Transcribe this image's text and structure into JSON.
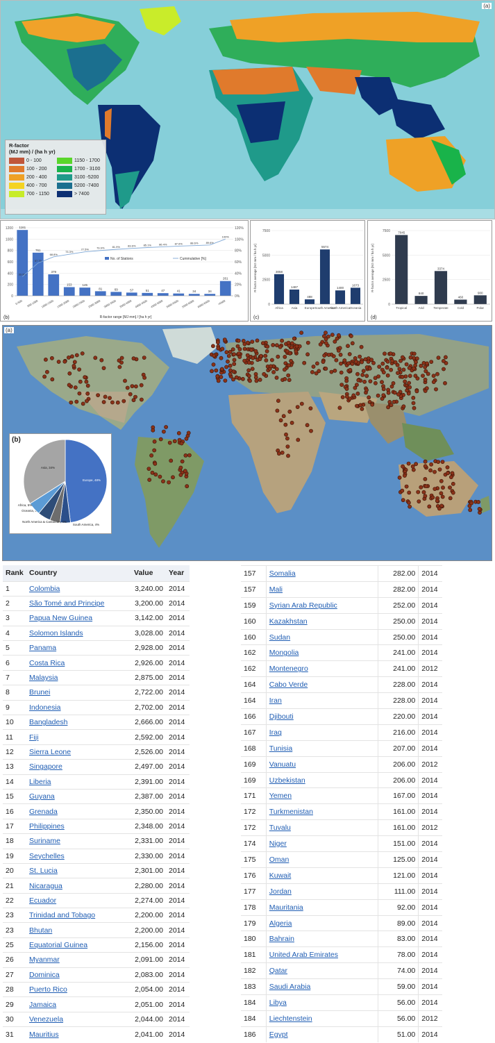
{
  "rfactor_map": {
    "label": "(a)",
    "legend_title": "R-factor\n(MJ mm) / (ha h yr)",
    "legend_title_line1": "R-factor",
    "legend_title_line2": "(MJ mm) / (ha h yr)",
    "legend": [
      {
        "label": "0 - 100",
        "color": "#c0563a"
      },
      {
        "label": "1150 - 1700",
        "color": "#59d62a"
      },
      {
        "label": "100 - 200",
        "color": "#e07a2c"
      },
      {
        "label": "1700 - 3100",
        "color": "#19b34a"
      },
      {
        "label": "200 - 400",
        "color": "#efa126"
      },
      {
        "label": "3100 -5200",
        "color": "#1f9a8a"
      },
      {
        "label": "400 - 700",
        "color": "#f4d322"
      },
      {
        "label": "5200 -7400",
        "color": "#1b6f8f"
      },
      {
        "label": "700 - 1150",
        "color": "#c7ec2a"
      },
      {
        "label": "> 7400",
        "color": "#0c2f73"
      }
    ]
  },
  "chart_b": {
    "label": "(b)",
    "series_bar": "No. of Stations",
    "series_line": "Cummulative [%]",
    "xlabel": "R-factor range [MJ mm] / [ha h yr]",
    "chart_data": {
      "type": "bar",
      "categories": [
        "0-500",
        "500-1000",
        "1000-1500",
        "1500-2000",
        "2000-2500",
        "2500-3000",
        "3000-3500",
        "3500-4000",
        "4000-4500",
        "4500-5000",
        "5000-5500",
        "5500-6000",
        "6000-6500",
        ">6500"
      ],
      "values": [
        1161,
        761,
        379,
        153,
        145,
        81,
        69,
        57,
        51,
        47,
        41,
        34,
        34,
        261
      ],
      "cumulative": [
        33.9,
        57.75,
        68.8,
        73.3,
        77.5,
        79.9,
        81.9,
        83.6,
        85.1,
        86.4,
        87.6,
        88.6,
        89.6,
        100
      ],
      "bar_labels": [
        "1161",
        "761",
        "379",
        "153",
        "145",
        "81",
        "69",
        "57",
        "51",
        "47",
        "41",
        "34",
        "34",
        "261"
      ],
      "cum_labels": [
        "33.9%",
        "57.75",
        "68.8%",
        "73.3%",
        "77.5%",
        "79.9%",
        "81.9%",
        "83.6%",
        "85.1%",
        "86.4%",
        "87.6%",
        "88.6%",
        "89.6%",
        "100%"
      ],
      "yticks": [
        "0",
        "200",
        "400",
        "600",
        "800",
        "1000",
        "1200"
      ],
      "y2ticks": [
        "0%",
        "20%",
        "40%",
        "60%",
        "80%",
        "100%",
        "120%"
      ],
      "ylim": [
        0,
        1200
      ]
    }
  },
  "chart_c": {
    "label": "(c)",
    "ylabel": "R-factor average [MJ mm / ha h yr]",
    "chart_data": {
      "type": "bar",
      "categories": [
        "Africa",
        "Asia",
        "Europe",
        "South America",
        "North America",
        "Oceania"
      ],
      "values": [
        3058,
        1487,
        488,
        5574,
        1400,
        1673
      ],
      "bar_labels": [
        "3058",
        "1487",
        "488",
        "5574",
        "1400",
        "1673"
      ],
      "yticks": [
        "0",
        "2500",
        "5000",
        "7500"
      ],
      "ylim": [
        0,
        7500
      ]
    }
  },
  "chart_d": {
    "label": "(d)",
    "ylabel": "R-factor average [MJ mm / ha h yr]",
    "chart_data": {
      "type": "bar",
      "categories": [
        "Tropical",
        "Arid",
        "Temperate",
        "Cold",
        "Polar"
      ],
      "values": [
        7045,
        840,
        3374,
        460,
        900
      ],
      "bar_labels": [
        "7045",
        "840",
        "3374",
        "460",
        "900"
      ],
      "yticks": [
        "0",
        "2500",
        "5000",
        "7500"
      ],
      "ylim": [
        0,
        7500
      ]
    }
  },
  "station_map": {
    "label": "(a)",
    "pie_label": "(b)",
    "pie_data": {
      "type": "pie",
      "slices": [
        {
          "name": "Europe, 48%",
          "value": 48,
          "color": "#4472c4"
        },
        {
          "name": "South America, 4%",
          "value": 4,
          "color": "#2b4f8a"
        },
        {
          "name": "North America & Caribbean, 4%",
          "value": 4,
          "color": "#6d6d6d"
        },
        {
          "name": "Oceania, 5%",
          "value": 5,
          "color": "#2e4d78"
        },
        {
          "name": "Africa, 5%",
          "value": 5,
          "color": "#5b9bd5"
        },
        {
          "name": "Asia, 34%",
          "value": 34,
          "color": "#a5a5a5"
        }
      ]
    }
  },
  "table_left": {
    "headers": [
      "Rank",
      "Country",
      "Value",
      "Year"
    ],
    "rows": [
      [
        "1",
        "Colombia",
        "3,240.00",
        "2014"
      ],
      [
        "2",
        "São Tomé and Principe",
        "3,200.00",
        "2014"
      ],
      [
        "3",
        "Papua New Guinea",
        "3,142.00",
        "2014"
      ],
      [
        "4",
        "Solomon Islands",
        "3,028.00",
        "2014"
      ],
      [
        "5",
        "Panama",
        "2,928.00",
        "2014"
      ],
      [
        "6",
        "Costa Rica",
        "2,926.00",
        "2014"
      ],
      [
        "7",
        "Malaysia",
        "2,875.00",
        "2014"
      ],
      [
        "8",
        "Brunei",
        "2,722.00",
        "2014"
      ],
      [
        "9",
        "Indonesia",
        "2,702.00",
        "2014"
      ],
      [
        "10",
        "Bangladesh",
        "2,666.00",
        "2014"
      ],
      [
        "11",
        "Fiji",
        "2,592.00",
        "2014"
      ],
      [
        "12",
        "Sierra Leone",
        "2,526.00",
        "2014"
      ],
      [
        "13",
        "Singapore",
        "2,497.00",
        "2014"
      ],
      [
        "14",
        "Liberia",
        "2,391.00",
        "2014"
      ],
      [
        "15",
        "Guyana",
        "2,387.00",
        "2014"
      ],
      [
        "16",
        "Grenada",
        "2,350.00",
        "2014"
      ],
      [
        "17",
        "Philippines",
        "2,348.00",
        "2014"
      ],
      [
        "18",
        "Suriname",
        "2,331.00",
        "2014"
      ],
      [
        "19",
        "Seychelles",
        "2,330.00",
        "2014"
      ],
      [
        "20",
        "St. Lucia",
        "2,301.00",
        "2014"
      ],
      [
        "21",
        "Nicaragua",
        "2,280.00",
        "2014"
      ],
      [
        "22",
        "Ecuador",
        "2,274.00",
        "2014"
      ],
      [
        "23",
        "Trinidad and Tobago",
        "2,200.00",
        "2014"
      ],
      [
        "23",
        "Bhutan",
        "2,200.00",
        "2014"
      ],
      [
        "25",
        "Equatorial Guinea",
        "2,156.00",
        "2014"
      ],
      [
        "26",
        "Myanmar",
        "2,091.00",
        "2014"
      ],
      [
        "27",
        "Dominica",
        "2,083.00",
        "2014"
      ],
      [
        "28",
        "Puerto Rico",
        "2,054.00",
        "2014"
      ],
      [
        "29",
        "Jamaica",
        "2,051.00",
        "2014"
      ],
      [
        "30",
        "Venezuela",
        "2,044.00",
        "2014"
      ],
      [
        "31",
        "Mauritius",
        "2,041.00",
        "2014"
      ]
    ]
  },
  "table_right": {
    "rows": [
      [
        "157",
        "Somalia",
        "282.00",
        "2014"
      ],
      [
        "157",
        "Mali",
        "282.00",
        "2014"
      ],
      [
        "159",
        "Syrian Arab Republic",
        "252.00",
        "2014"
      ],
      [
        "160",
        "Kazakhstan",
        "250.00",
        "2014"
      ],
      [
        "160",
        "Sudan",
        "250.00",
        "2014"
      ],
      [
        "162",
        "Mongolia",
        "241.00",
        "2014"
      ],
      [
        "162",
        "Montenegro",
        "241.00",
        "2012"
      ],
      [
        "164",
        "Cabo Verde",
        "228.00",
        "2014"
      ],
      [
        "164",
        "Iran",
        "228.00",
        "2014"
      ],
      [
        "166",
        "Djibouti",
        "220.00",
        "2014"
      ],
      [
        "167",
        "Iraq",
        "216.00",
        "2014"
      ],
      [
        "168",
        "Tunisia",
        "207.00",
        "2014"
      ],
      [
        "169",
        "Vanuatu",
        "206.00",
        "2012"
      ],
      [
        "169",
        "Uzbekistan",
        "206.00",
        "2014"
      ],
      [
        "171",
        "Yemen",
        "167.00",
        "2014"
      ],
      [
        "172",
        "Turkmenistan",
        "161.00",
        "2014"
      ],
      [
        "172",
        "Tuvalu",
        "161.00",
        "2012"
      ],
      [
        "174",
        "Niger",
        "151.00",
        "2014"
      ],
      [
        "175",
        "Oman",
        "125.00",
        "2014"
      ],
      [
        "176",
        "Kuwait",
        "121.00",
        "2014"
      ],
      [
        "177",
        "Jordan",
        "111.00",
        "2014"
      ],
      [
        "178",
        "Mauritania",
        "92.00",
        "2014"
      ],
      [
        "179",
        "Algeria",
        "89.00",
        "2014"
      ],
      [
        "180",
        "Bahrain",
        "83.00",
        "2014"
      ],
      [
        "181",
        "United Arab Emirates",
        "78.00",
        "2014"
      ],
      [
        "182",
        "Qatar",
        "74.00",
        "2014"
      ],
      [
        "183",
        "Saudi Arabia",
        "59.00",
        "2014"
      ],
      [
        "184",
        "Libya",
        "56.00",
        "2014"
      ],
      [
        "184",
        "Liechtenstein",
        "56.00",
        "2012"
      ],
      [
        "186",
        "Egypt",
        "51.00",
        "2014"
      ]
    ]
  }
}
